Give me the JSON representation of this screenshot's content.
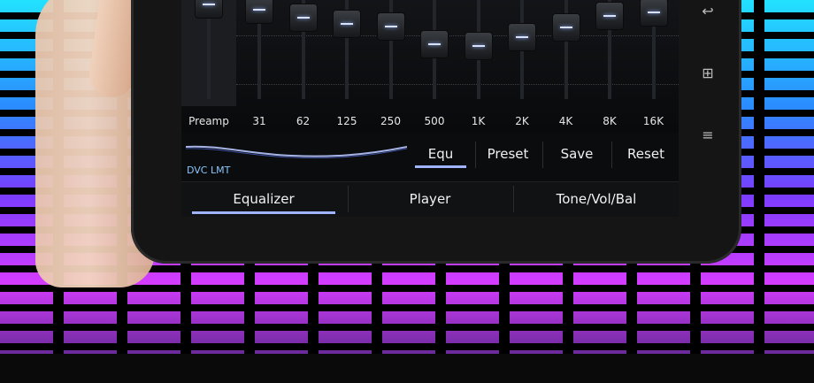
{
  "preamp_label": "Preamp",
  "bands": [
    {
      "label": "31",
      "level": 0.95
    },
    {
      "label": "62",
      "level": 0.87
    },
    {
      "label": "125",
      "level": 0.8
    },
    {
      "label": "250",
      "level": 0.78
    },
    {
      "label": "500",
      "level": 0.6
    },
    {
      "label": "1K",
      "level": 0.58
    },
    {
      "label": "2K",
      "level": 0.67
    },
    {
      "label": "4K",
      "level": 0.77
    },
    {
      "label": "8K",
      "level": 0.88
    },
    {
      "label": "16K",
      "level": 0.92
    }
  ],
  "dvc_label": "DVC LMT",
  "controls": {
    "equ": "Equ",
    "preset": "Preset",
    "save": "Save",
    "reset": "Reset"
  },
  "tabs": [
    "Equalizer",
    "Player",
    "Tone/Vol/Bal"
  ],
  "device_buttons": {
    "back": "back-icon",
    "home": "home-grid-icon",
    "menu": "menu-icon"
  }
}
